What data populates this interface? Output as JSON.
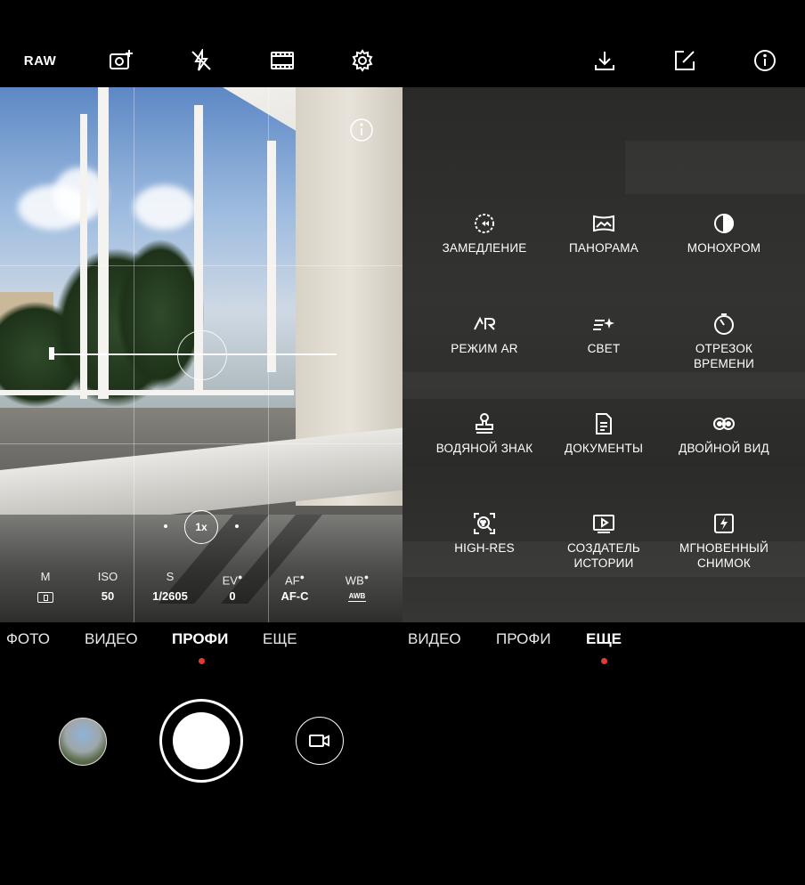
{
  "left_topbar": {
    "raw_label": "RAW",
    "icons": [
      "add-photo-icon",
      "flash-off-icon",
      "film-aspect-icon",
      "gear-icon"
    ]
  },
  "right_topbar": {
    "icons": [
      "download-icon",
      "edit-icon",
      "info-icon"
    ]
  },
  "viewfinder": {
    "zoom": "1x",
    "params": [
      {
        "label": "M",
        "value_icon": "metering-icon"
      },
      {
        "label": "ISO",
        "value": "50"
      },
      {
        "label": "S",
        "value": "1/2605"
      },
      {
        "label": "EV",
        "value": "0"
      },
      {
        "label": "AF",
        "value": "AF-C"
      },
      {
        "label": "WB",
        "value_badge": "AWB"
      }
    ]
  },
  "more_modes": [
    {
      "label": "ЗАМЕДЛЕНИЕ",
      "icon": "slow-motion-icon"
    },
    {
      "label": "ПАНОРАМА",
      "icon": "panorama-icon"
    },
    {
      "label": "МОНОХРОМ",
      "icon": "monochrome-icon"
    },
    {
      "label": "РЕЖИМ AR",
      "icon": "ar-icon"
    },
    {
      "label": "СВЕТ",
      "icon": "light-painting-icon"
    },
    {
      "label": "ОТРЕЗОК\nВРЕМЕНИ",
      "icon": "time-lapse-icon"
    },
    {
      "label": "ВОДЯНОЙ ЗНАК",
      "icon": "stamp-icon"
    },
    {
      "label": "ДОКУМЕНТЫ",
      "icon": "document-icon"
    },
    {
      "label": "ДВОЙНОЙ ВИД",
      "icon": "dual-view-icon"
    },
    {
      "label": "HIGH-RES",
      "icon": "high-res-icon"
    },
    {
      "label": "СОЗДАТЕЛЬ\nИСТОРИИ",
      "icon": "story-creator-icon"
    },
    {
      "label": "МГНОВЕННЫЙ\nСНИМОК",
      "icon": "snapshot-icon"
    }
  ],
  "left_tabs": [
    "ФОТО",
    "ВИДЕО",
    "ПРОФИ",
    "ЕЩЕ"
  ],
  "left_active_tab": "ПРОФИ",
  "right_tabs": [
    "ВИДЕО",
    "ПРОФИ",
    "ЕЩЕ"
  ],
  "right_active_tab": "ЕЩЕ",
  "colors": {
    "accent_dot": "#e53a2f",
    "background": "#000000",
    "text": "#ffffff"
  }
}
